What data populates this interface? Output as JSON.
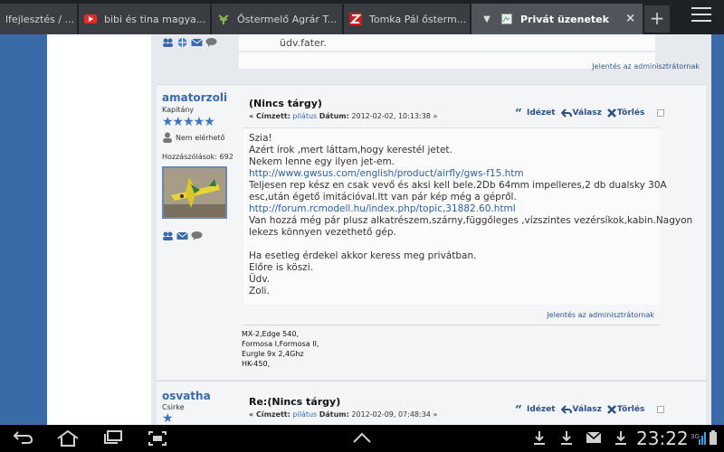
{
  "tabs": [
    {
      "title": "lfejlesztés / ...",
      "active": false
    },
    {
      "title": "bibi és tina magya...",
      "active": false
    },
    {
      "title": "Őstermelő Agrár T...",
      "active": false
    },
    {
      "title": "Tomka Pál ősterm...",
      "active": false
    },
    {
      "title": "Privát üzenetek",
      "active": true
    }
  ],
  "tab_close": "×",
  "new_tab": "+",
  "prev_post": {
    "text_tail": "üdv.fater.",
    "report_label": "Jelentés az adminisztrátornak"
  },
  "post1": {
    "author": "amatorzoli",
    "rank": "Kapitány",
    "stars": "★★★★★",
    "status": "Nem elérhető",
    "post_count": "Hozzászólások: 692",
    "subject": "(Nincs tárgy)",
    "meta_prefix": "« Címzett:",
    "recipient": "pilátus",
    "date_label": "Dátum:",
    "date": "2012-02-02, 10:13:38 »",
    "quote_label": "Idézet",
    "reply_label": "Válasz",
    "delete_label": "Törlés",
    "message_lines": [
      "Szia!",
      "Azért írok ,mert láttam,hogy kerestél jetet.",
      "Nekem lenne egy ilyen jet-em.",
      "http://www.gwsus.com/english/product/airfly/gws-f15.htm",
      "Teljesen rep kész en csak vevő és aksi kell bele.2Db 64mm impelleres,2 db dualsky 30A",
      "esc,után égető imitációval.Itt van pár kép még a gépről.",
      "http://forum.rcmodell.hu/index.php/topic,31882.60.html",
      "Van hozzá még pár plusz alkatrészem,szárny,függőleges ,vízszintes vezérsíkok,kabin.Nagyon",
      "lekezs könnyen vezethető gép.",
      "",
      "Ha esetleg érdekel akkor keress meg privátban.",
      "Előre is köszi.",
      "Üdv.",
      "Zoli."
    ],
    "report_label": "Jelentés az adminisztrátornak",
    "signature": [
      "MX-2,Edge 540,",
      "Formosa I,Formosa II,",
      "Eurgle 9x 2,4Ghz",
      "HK-450,"
    ]
  },
  "post2": {
    "author": "osvatha",
    "rank": "Csirke",
    "stars": "★",
    "subject": "Re:(Nincs tárgy)",
    "meta_prefix": "« Címzett:",
    "recipient": "pilátus",
    "date_label": "Dátum:",
    "date": "2012-02-09, 07:48:34 »",
    "quote_label": "Idézet",
    "reply_label": "Válasz",
    "delete_label": "Törlés"
  },
  "statusbar": {
    "time": "23:22",
    "signal": "3G"
  },
  "colors": {
    "accent": "#3a6aa8",
    "link": "#2e5f9e",
    "tabbar": "#1e2226"
  }
}
